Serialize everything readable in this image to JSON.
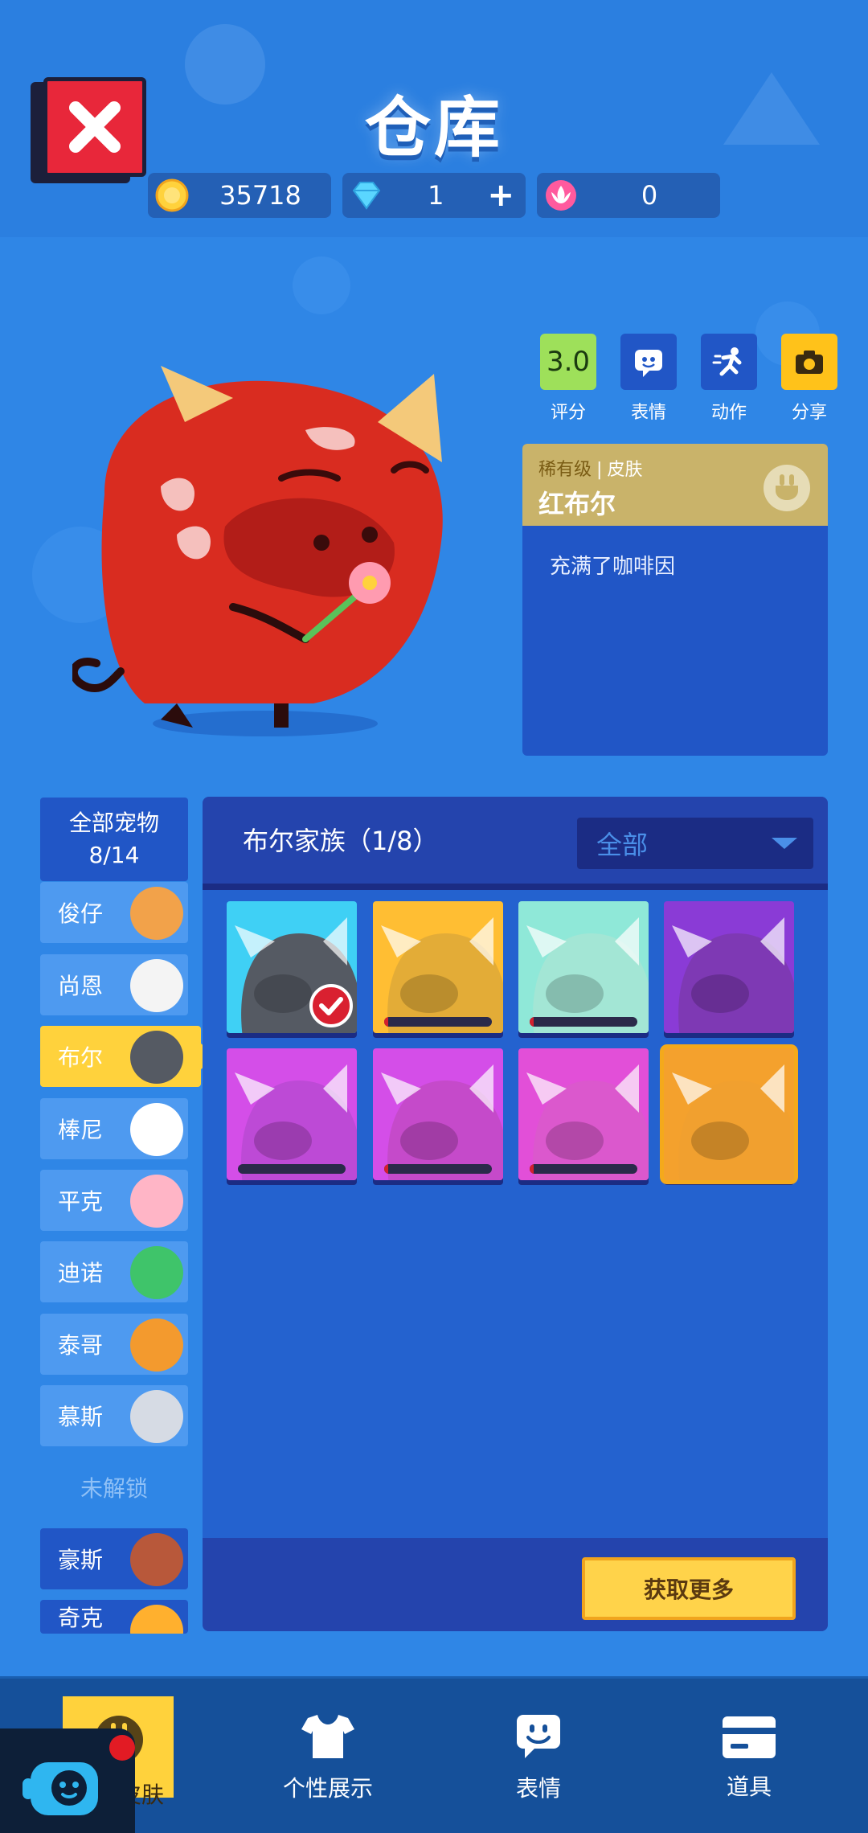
{
  "window": {
    "title": "仓库"
  },
  "currencies": [
    {
      "name": "coin",
      "icon": "coin-icon",
      "value": "35718",
      "color": "#ffd23c"
    },
    {
      "name": "diamond",
      "icon": "diamond-icon",
      "value": "1",
      "add_label": "+",
      "color": "#5ad6ff"
    },
    {
      "name": "lotus",
      "icon": "lotus-icon",
      "value": "0",
      "color": "#ff5a9e"
    }
  ],
  "actions": [
    {
      "label": "评分",
      "value": "3.0",
      "icon": "rating-icon"
    },
    {
      "label": "表情",
      "icon": "emote-icon"
    },
    {
      "label": "动作",
      "icon": "run-icon"
    },
    {
      "label": "分享",
      "icon": "camera-icon"
    }
  ],
  "skin_info": {
    "rarity": "稀有级",
    "separator": "|",
    "kind": "皮肤",
    "name": "红布尔",
    "description": "充满了咖啡因"
  },
  "pet_list": {
    "header_title": "全部宠物",
    "header_count": "8/14",
    "items": [
      {
        "label": "俊仔",
        "thumb_color": "#f2a24a"
      },
      {
        "label": "尚恩",
        "thumb_color": "#f4f4f4"
      },
      {
        "label": "布尔",
        "thumb_color": "#555a63",
        "active": true
      },
      {
        "label": "棒尼",
        "thumb_color": "#ffffff"
      },
      {
        "label": "平克",
        "thumb_color": "#ffb5c6"
      },
      {
        "label": "迪诺",
        "thumb_color": "#3fc46a"
      },
      {
        "label": "泰哥",
        "thumb_color": "#f39a2e"
      },
      {
        "label": "慕斯",
        "thumb_color": "#d6dbe4"
      }
    ],
    "locked_label": "未解锁",
    "locked_items": [
      {
        "label": "豪斯",
        "thumb_color": "#b8583a"
      },
      {
        "label": "奇克",
        "thumb_color": "#ffb02e"
      }
    ]
  },
  "skin_grid": {
    "family_title": "布尔家族（1/8）",
    "filter_value": "全部",
    "tiles": [
      {
        "bg": "#3fd0f5",
        "body": "#555a63",
        "progress": null,
        "equipped": true
      },
      {
        "bg": "#ffbe33",
        "body": "#d9a53a",
        "progress": 0.04
      },
      {
        "bg": "#8fe8d8",
        "body": "#a9e6d4",
        "progress": 0.04
      },
      {
        "bg": "#8a3bd6",
        "body": "#7a3aa8",
        "progress": null
      },
      {
        "bg": "#d44ee8",
        "body": "#b64ad0",
        "progress": 0.0
      },
      {
        "bg": "#d44ee8",
        "body": "#c04ac0",
        "progress": 0.04
      },
      {
        "bg": "#e24fd8",
        "body": "#d85bc9",
        "progress": 0.04
      },
      {
        "bg": "#f4a12d",
        "body": "#f0a030",
        "progress": null,
        "current": true
      }
    ],
    "more_button": "获取更多"
  },
  "bottom_nav": [
    {
      "label": "宠物皮肤",
      "icon": "plug-icon",
      "active": true
    },
    {
      "label": "个性展示",
      "icon": "shirt-icon"
    },
    {
      "label": "表情",
      "icon": "emote-bubble-icon"
    },
    {
      "label": "道具",
      "icon": "card-icon"
    }
  ]
}
